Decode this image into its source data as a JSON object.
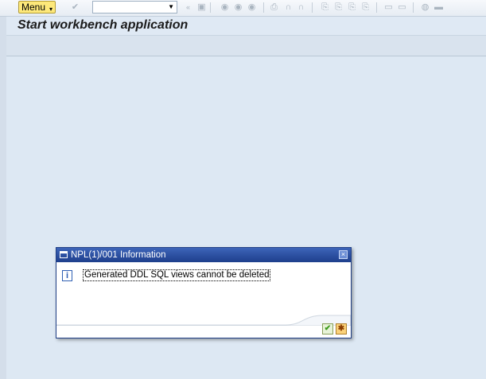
{
  "toolbar": {
    "menu_label": "Menu",
    "command_field": {
      "value": "",
      "placeholder": ""
    },
    "icons": [
      "check-icon",
      "save-icon",
      "back-icon",
      "exit-icon",
      "cancel-icon",
      "print-icon",
      "find-icon",
      "find-next-icon",
      "first-page-icon",
      "prev-page-icon",
      "next-page-icon",
      "last-page-icon",
      "new-session-icon",
      "shortcut-icon",
      "help-icon",
      "customize-icon"
    ]
  },
  "screen": {
    "title": "Start workbench application"
  },
  "dialog": {
    "title": "NPL(1)/001 Information",
    "message": "Generated DDL SQL views cannot be deleted",
    "colors": {
      "title_bar": "#2b4fa0",
      "info_icon": "#2f5fb3"
    }
  }
}
